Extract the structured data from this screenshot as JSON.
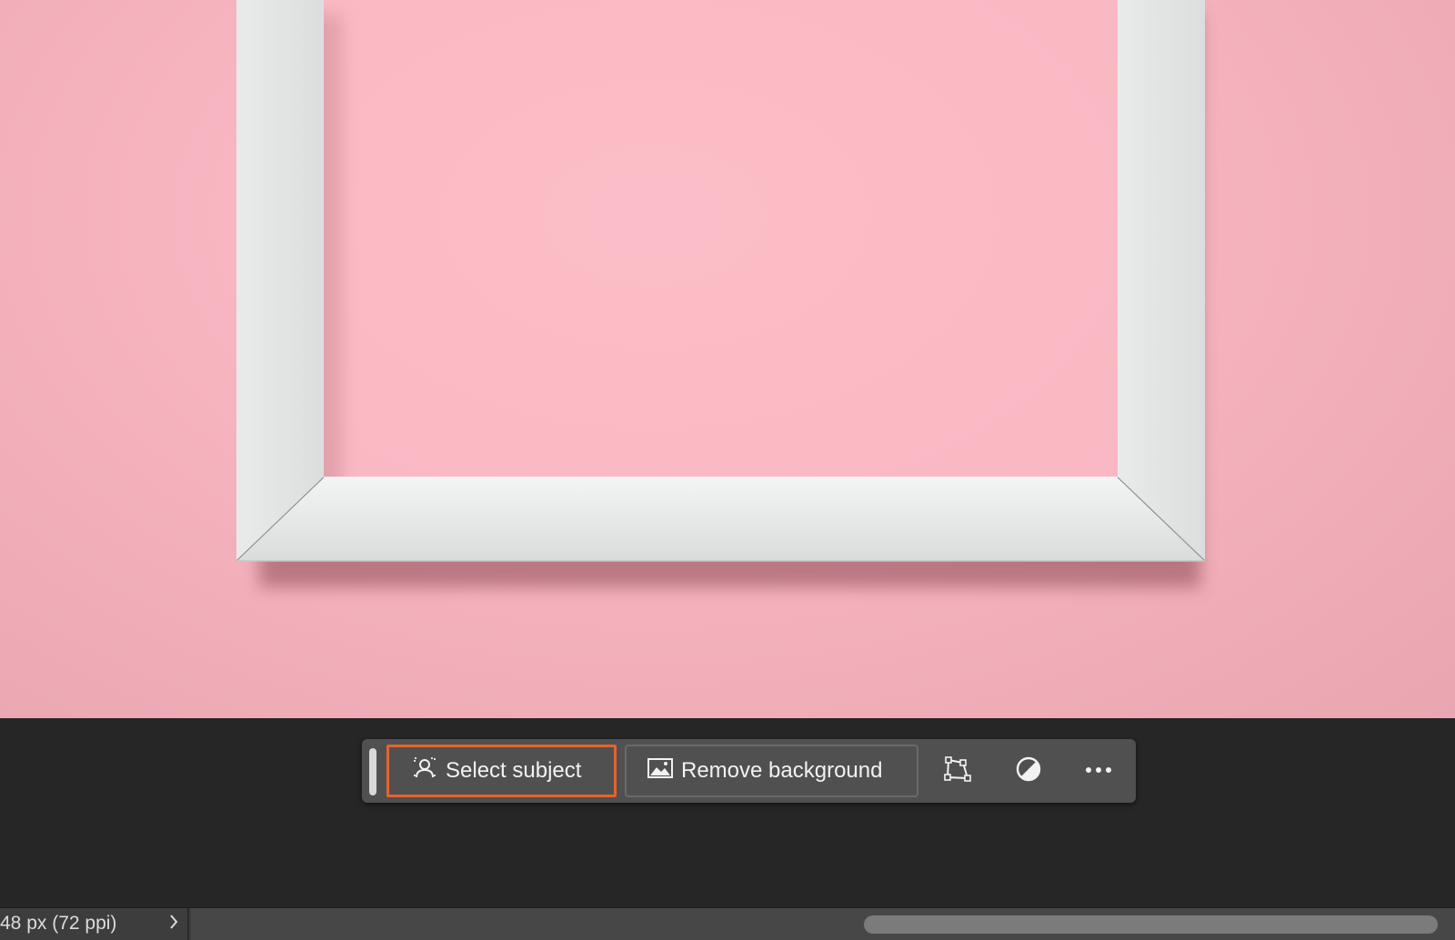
{
  "canvas": {
    "background_color": "#f7b7c1",
    "frame_color": "#e8e9e9"
  },
  "taskbar": {
    "select_subject_label": "Select subject",
    "remove_background_label": "Remove background",
    "highlight_color": "#e2642f",
    "icons": {
      "select_subject": "person-selection-icon",
      "remove_background": "image-icon",
      "transform": "transform-quad-icon",
      "adjustment": "half-circle-adjust-icon",
      "more": "ellipsis-icon"
    }
  },
  "statusbar": {
    "doc_info": "48 px (72 ppi)",
    "chevron_icon": "chevron-right-icon"
  }
}
